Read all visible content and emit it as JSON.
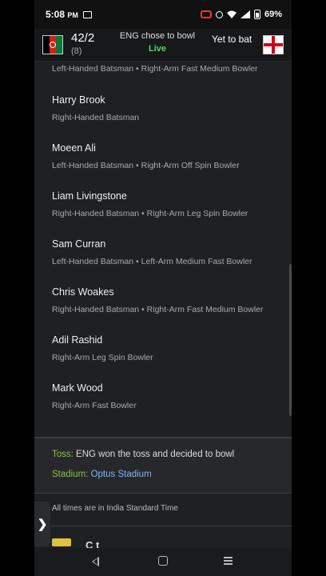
{
  "status_bar": {
    "time": "5:08",
    "ampm": "PM",
    "battery": "69%"
  },
  "header": {
    "team1_score": "42/2",
    "team1_overs": "(8)",
    "toss_summary": "ENG chose to bowl",
    "live_label": "Live",
    "team2_status": "Yet to bat"
  },
  "players": {
    "cut_off_role": "Left-Handed Batsman • Right-Arm Fast Medium Bowler",
    "items": [
      {
        "name": "Harry Brook",
        "role": "Right-Handed Batsman"
      },
      {
        "name": "Moeen Ali",
        "role": "Left-Handed Batsman • Right-Arm Off Spin Bowler"
      },
      {
        "name": "Liam Livingstone",
        "role": "Right-Handed Batsman • Right-Arm Leg Spin Bowler"
      },
      {
        "name": "Sam Curran",
        "role": "Left-Handed Batsman • Left-Arm Medium Fast Bowler"
      },
      {
        "name": "Chris Woakes",
        "role": "Right-Handed Batsman • Right-Arm Fast Medium Bowler"
      },
      {
        "name": "Adil Rashid",
        "role": "Right-Arm Leg Spin Bowler"
      },
      {
        "name": "Mark Wood",
        "role": "Right-Arm Fast Bowler"
      }
    ]
  },
  "match_info": {
    "toss_label": "Toss:",
    "toss_value": "ENG won the toss and decided to bowl",
    "stadium_label": "Stadium:",
    "stadium_value": "Optus Stadium",
    "timezone_note": "All times are in India Standard Time"
  },
  "next_section_partial": "C  t",
  "side_handle_glyph": "❯",
  "colors": {
    "live": "#4cd964",
    "info_label": "#8bc34a",
    "link": "#7fb3ff",
    "afghanistan_flag": [
      "#000000",
      "#d32011",
      "#007a36"
    ],
    "england_flag": [
      "#ffffff",
      "#d0021b"
    ]
  }
}
